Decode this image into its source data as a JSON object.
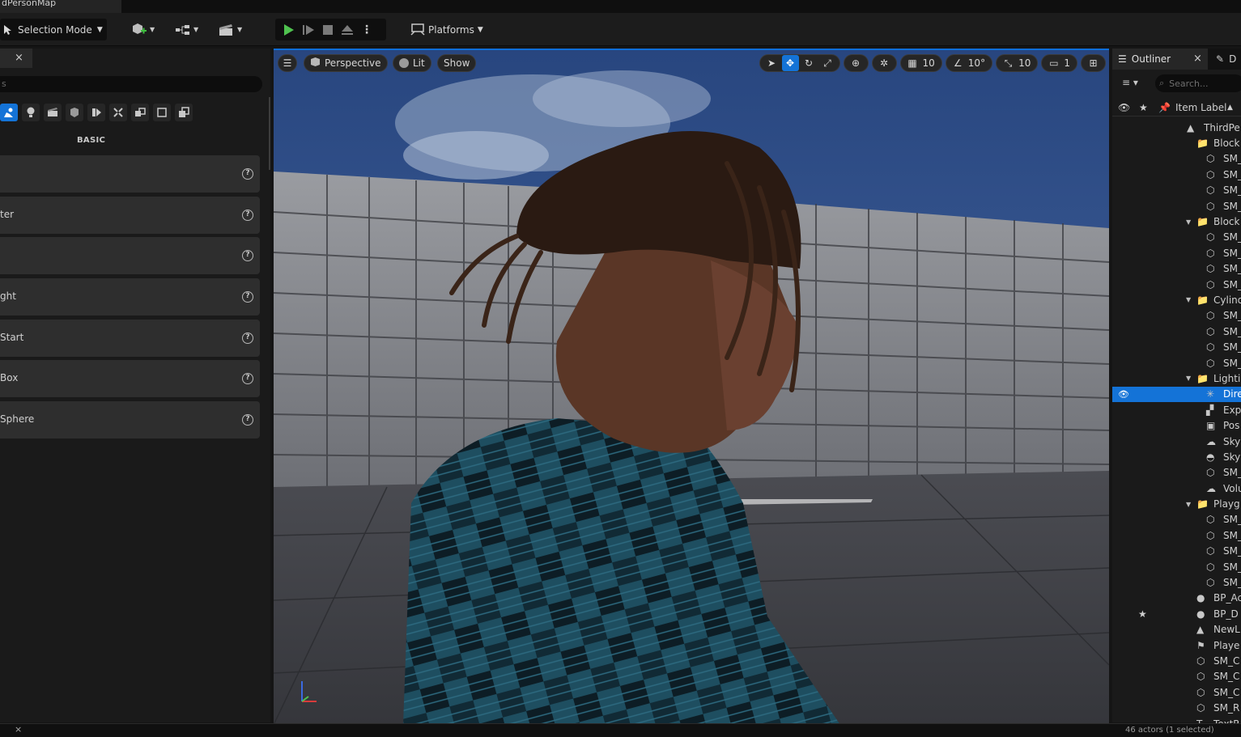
{
  "window": {
    "map_tab": "dPersonMap"
  },
  "toolbar": {
    "selection_mode": "Selection Mode",
    "platforms": "Platforms"
  },
  "place_actors": {
    "close": "×",
    "search_placeholder": "s",
    "category_label": "BASIC",
    "items": [
      {
        "label": ""
      },
      {
        "label": "ter"
      },
      {
        "label": ""
      },
      {
        "label": "ght"
      },
      {
        "label": "Start"
      },
      {
        "label": "Box"
      },
      {
        "label": "Sphere"
      }
    ],
    "help": "?"
  },
  "viewport": {
    "view_mode": "Perspective",
    "lighting": "Lit",
    "show": "Show",
    "grid_snap": "10",
    "rotation_snap": "10°",
    "scale_snap": "10",
    "camera_speed": "1"
  },
  "outliner": {
    "tab_label": "Outliner",
    "close": "×",
    "details_tab": "D",
    "search_placeholder": "Search...",
    "column_item_label": "Item Label",
    "rows": [
      {
        "label": "ThirdPe",
        "indent": 0,
        "icon": "level",
        "arrow": false
      },
      {
        "label": "Block",
        "indent": 1,
        "icon": "folder",
        "arrow": false
      },
      {
        "label": "SM_",
        "indent": 2,
        "icon": "mesh"
      },
      {
        "label": "SM_",
        "indent": 2,
        "icon": "mesh"
      },
      {
        "label": "SM_",
        "indent": 2,
        "icon": "mesh"
      },
      {
        "label": "SM_",
        "indent": 2,
        "icon": "mesh"
      },
      {
        "label": "Block",
        "indent": 1,
        "icon": "folder",
        "arrow": true
      },
      {
        "label": "SM_",
        "indent": 2,
        "icon": "mesh"
      },
      {
        "label": "SM_",
        "indent": 2,
        "icon": "mesh"
      },
      {
        "label": "SM_",
        "indent": 2,
        "icon": "mesh"
      },
      {
        "label": "SM_",
        "indent": 2,
        "icon": "mesh"
      },
      {
        "label": "Cylind",
        "indent": 1,
        "icon": "folder",
        "arrow": true
      },
      {
        "label": "SM_",
        "indent": 2,
        "icon": "mesh"
      },
      {
        "label": "SM_",
        "indent": 2,
        "icon": "mesh"
      },
      {
        "label": "SM_",
        "indent": 2,
        "icon": "mesh"
      },
      {
        "label": "SM_",
        "indent": 2,
        "icon": "mesh"
      },
      {
        "label": "Lightin",
        "indent": 1,
        "icon": "folder",
        "arrow": true
      },
      {
        "label": "Dire",
        "indent": 2,
        "icon": "light",
        "selected": true
      },
      {
        "label": "Exp",
        "indent": 2,
        "icon": "exposure"
      },
      {
        "label": "Pos",
        "indent": 2,
        "icon": "postprocess"
      },
      {
        "label": "Sky",
        "indent": 2,
        "icon": "skylight"
      },
      {
        "label": "Sky",
        "indent": 2,
        "icon": "sky"
      },
      {
        "label": "SM_",
        "indent": 2,
        "icon": "mesh"
      },
      {
        "label": "Volu",
        "indent": 2,
        "icon": "cloud"
      },
      {
        "label": "Playg",
        "indent": 1,
        "icon": "folder",
        "arrow": true
      },
      {
        "label": "SM_",
        "indent": 2,
        "icon": "mesh"
      },
      {
        "label": "SM_",
        "indent": 2,
        "icon": "mesh"
      },
      {
        "label": "SM_",
        "indent": 2,
        "icon": "mesh"
      },
      {
        "label": "SM_",
        "indent": 2,
        "icon": "mesh"
      },
      {
        "label": "SM_",
        "indent": 2,
        "icon": "mesh"
      },
      {
        "label": "BP_Ac",
        "indent": 1,
        "icon": "actor"
      },
      {
        "label": "BP_D",
        "indent": 1,
        "icon": "actor",
        "starred": true
      },
      {
        "label": "NewL",
        "indent": 1,
        "icon": "level"
      },
      {
        "label": "Playe",
        "indent": 1,
        "icon": "playerstart"
      },
      {
        "label": "SM_C",
        "indent": 1,
        "icon": "mesh"
      },
      {
        "label": "SM_C",
        "indent": 1,
        "icon": "mesh"
      },
      {
        "label": "SM_C",
        "indent": 1,
        "icon": "mesh"
      },
      {
        "label": "SM_R",
        "indent": 1,
        "icon": "mesh"
      },
      {
        "label": "TextR",
        "indent": 1,
        "icon": "text"
      }
    ]
  },
  "status": {
    "close": "×",
    "outliner_count": "46 actors (1 selected)"
  },
  "colors": {
    "accent": "#1473d7",
    "panel": "#1a1a1a",
    "folder": "#d9a24f"
  }
}
